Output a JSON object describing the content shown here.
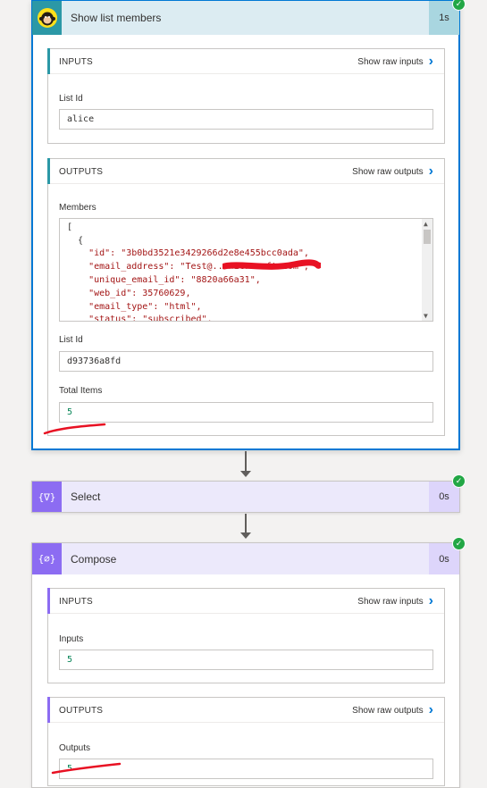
{
  "actions": {
    "list_members": {
      "title": "Show list members",
      "duration": "1s",
      "icon": "mailchimp-monkey-icon",
      "inputs": {
        "header": "INPUTS",
        "raw_link": "Show raw inputs",
        "list_id_label": "List Id",
        "list_id_value": "alice"
      },
      "outputs": {
        "header": "OUTPUTS",
        "raw_link": "Show raw outputs",
        "members_label": "Members",
        "members_json": [
          "[",
          "  {",
          "    \"id\": \"3b0bd3521e3429266d2e8e455bcc0ada\",",
          "    \"email_address\": \"Test@...microsoft.com\",",
          "    \"unique_email_id\": \"8820a66a31\",",
          "    \"web_id\": 35760629,",
          "    \"email_type\": \"html\",",
          "    \"status\": \"subscribed\","
        ],
        "list_id_label": "List Id",
        "list_id_value": "d93736a8fd",
        "total_items_label": "Total Items",
        "total_items_value": "5"
      }
    },
    "select": {
      "title": "Select",
      "duration": "0s",
      "icon": "select-braces-icon"
    },
    "compose": {
      "title": "Compose",
      "duration": "0s",
      "icon": "compose-braces-icon",
      "inputs": {
        "header": "INPUTS",
        "raw_link": "Show raw inputs",
        "field_label": "Inputs",
        "field_value": "5"
      },
      "outputs": {
        "header": "OUTPUTS",
        "raw_link": "Show raw outputs",
        "field_label": "Outputs",
        "field_value": "5"
      }
    }
  },
  "colors": {
    "mailchimp_header": "#dcecf2",
    "mailchimp_icon_bg": "#2b98a6",
    "mailchimp_duration_bg": "#a9d6e0",
    "data_header": "#ece9fb",
    "data_icon_bg": "#8c6cf2",
    "data_duration_bg": "#ddd5fb",
    "success": "#22a745",
    "link": "#0078d4"
  }
}
